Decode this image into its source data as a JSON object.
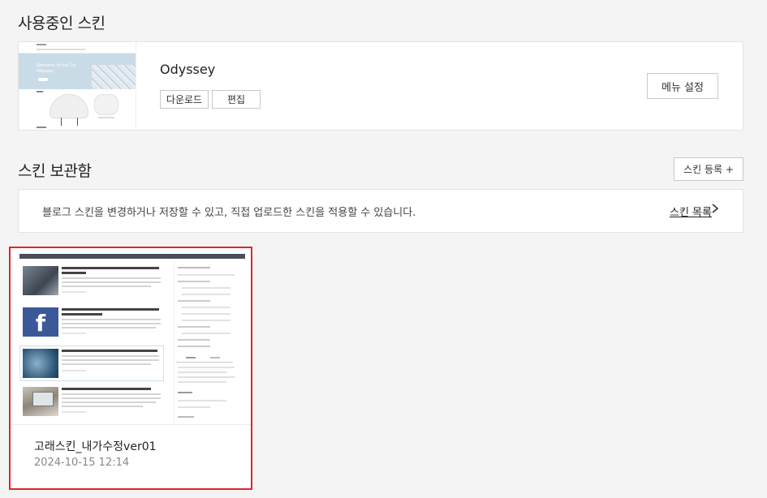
{
  "current_skin": {
    "heading": "사용중인 스킨",
    "name": "Odyssey",
    "download_label": "다운로드",
    "edit_label": "편집",
    "menu_settings_label": "메뉴 설정",
    "thumbnail": {
      "hero_line1": "Welcome to the 1st",
      "hero_line2": "Odyssey"
    }
  },
  "vault": {
    "heading": "스킨 보관함",
    "register_label": "스킨 등록 +",
    "info_text": "블로그 스킨을 변경하거나 저장할 수 있고, 직접 업로드한 스킨을 적용할 수 있습니다.",
    "list_link_label": "스킨 목록",
    "skins": [
      {
        "name": "고래스킨_내가수정ver01",
        "date": "2024-10-15 12:14",
        "selected": true,
        "preview_posts": [
          "한방재판소의 일은 국회의 동의를 받아 재판관중에서 대통령이 임명한다.",
          "Section 1.10.33 of \"de Finibus Bonorum et Malorum\", written by Cicero in 45 BC",
          "The standard Lorem Ipsum passage, used since the 1500s",
          "What is Lorem Ipsum? Where does it come from?"
        ]
      }
    ]
  },
  "colors": {
    "selected_border": "#e2242a",
    "facebook_blue": "#3b5998"
  }
}
